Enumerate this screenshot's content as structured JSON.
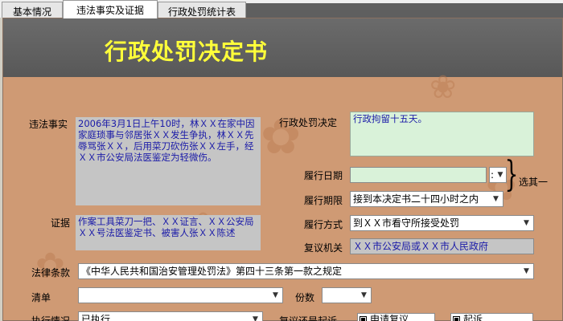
{
  "tabs": [
    {
      "label": "基本情况",
      "active": false
    },
    {
      "label": "违法事实及证据",
      "active": true
    },
    {
      "label": "行政处罚统计表",
      "active": false
    }
  ],
  "title": "行政处罚决定书",
  "labels": {
    "facts": "违法事实",
    "evidence": "证据",
    "decision": "行政处罚决定",
    "exec_date": "履行日期",
    "exec_period": "履行期限",
    "exec_mode": "履行方式",
    "review_org": "复议机关",
    "either_one": "选其一",
    "law": "法律条款",
    "list": "清单",
    "copies": "份数",
    "exec_status": "执行情况",
    "review_or_sue": "复议还是起诉"
  },
  "values": {
    "facts": "2006年3月1日上午10时，林ＸＸ在家中因家庭琐事与邻居张ＸＸ发生争执，林ＸＸ先辱骂张ＸＸ，后用菜刀砍伤张ＸＸ左手，经ＸＸ市公安局法医鉴定为轻微伤。",
    "evidence": "作案工具菜刀一把、ＸＸ证言、ＸＸ公安局ＸＸ号法医鉴定书、被害人张ＸＸ陈述",
    "decision": "行政拘留十五天。",
    "exec_date": "",
    "exec_date_sep": ":",
    "exec_period": "接到本决定书二十四小时之内",
    "exec_mode": "到ＸＸ市看守所接受处罚",
    "review_org": "ＸＸ市公安局或ＸＸ市人民政府",
    "law": "《中华人民共和国治安管理处罚法》第四十三条第一款之规定",
    "list": "",
    "copies": "",
    "exec_status": "已执行"
  },
  "checkboxes": {
    "review": "申请复议",
    "sue": "起诉"
  },
  "colors": {
    "title_text": "#ffff3a",
    "content_bg": "#cf9a74",
    "field_text": "#1a1aa8"
  }
}
